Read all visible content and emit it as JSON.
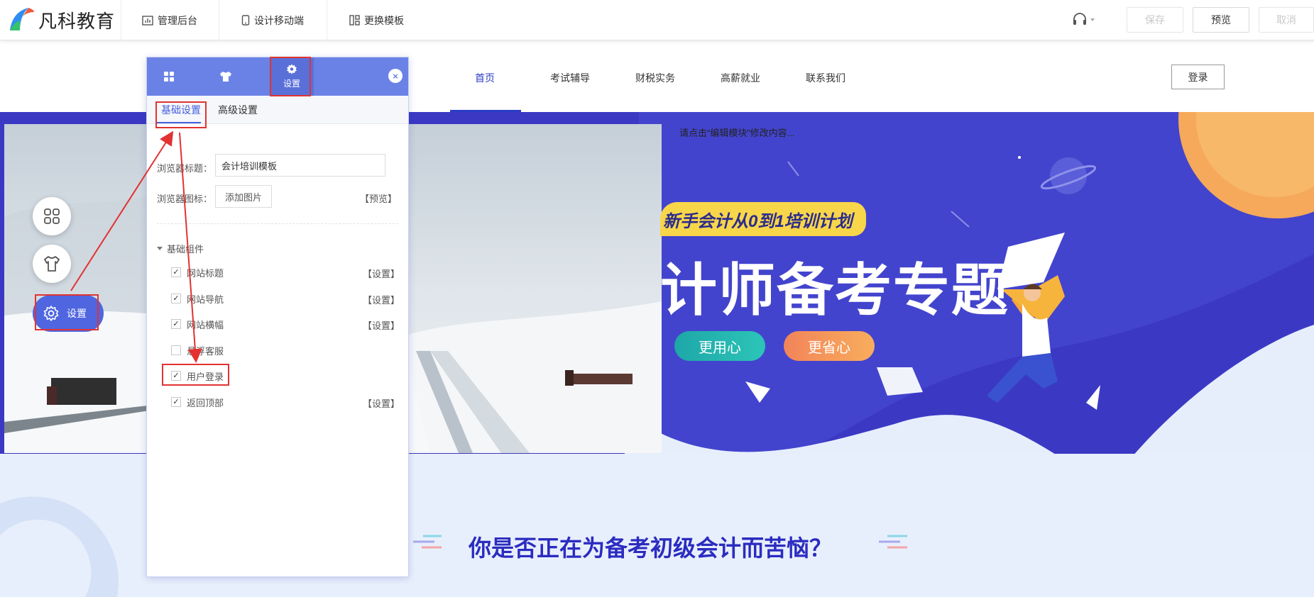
{
  "editor": {
    "logo_text": "凡科教育",
    "menu": [
      {
        "label": "管理后台",
        "icon": "chart-icon"
      },
      {
        "label": "设计移动端",
        "icon": "mobile-icon"
      },
      {
        "label": "更换模板",
        "icon": "template-icon"
      }
    ],
    "buttons": {
      "save": "保存",
      "preview": "预览",
      "cancel": "取消"
    }
  },
  "site": {
    "nav": [
      "首页",
      "考试辅导",
      "财税实务",
      "高薪就业",
      "联系我们"
    ],
    "active_nav": "首页",
    "login": "登录"
  },
  "hero": {
    "edit_hint": "请点击“编辑模块”修改内容...",
    "tag": "新手会计从0到1培训计划",
    "title": "计师备考专题",
    "pill_left": "更用心",
    "pill_right": "更省心"
  },
  "section": {
    "question": "你是否正在为备考初级会计而苦恼？"
  },
  "floating_tools": {
    "setting_label": "设置"
  },
  "panel": {
    "tabs": [
      {
        "icon": "grid-icon",
        "label": ""
      },
      {
        "icon": "shirt-icon",
        "label": ""
      },
      {
        "icon": "gear-icon",
        "label": "设置"
      }
    ],
    "subtabs": [
      "基础设置",
      "高级设置"
    ],
    "browser_title_label": "浏览器标题：",
    "browser_title_value": "会计培训模板",
    "browser_icon_label": "浏览器图标：",
    "add_image": "添加图片",
    "preview_link": "【预览】",
    "group_title": "基础组件",
    "components": [
      {
        "label": "网站标题",
        "checked": true,
        "action": "【设置】"
      },
      {
        "label": "网站导航",
        "checked": true,
        "action": "【设置】"
      },
      {
        "label": "网站横幅",
        "checked": true,
        "action": "【设置】"
      },
      {
        "label": "悬浮客服",
        "checked": false,
        "action": ""
      },
      {
        "label": "用户登录",
        "checked": true,
        "action": ""
      },
      {
        "label": "返回顶部",
        "checked": true,
        "action": "【设置】"
      }
    ]
  },
  "colors": {
    "accent": "#4660dd",
    "hero_bg": "#3d3cc8",
    "annotation": "#e23232"
  }
}
